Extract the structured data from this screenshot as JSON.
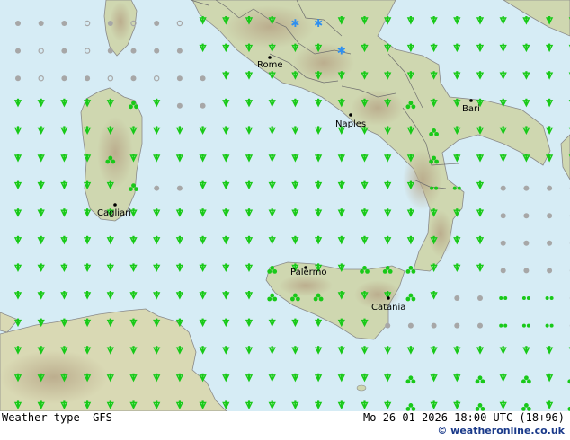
{
  "map": {
    "cities": [
      {
        "id": "rome",
        "name": "Rome"
      },
      {
        "id": "naples",
        "name": "Naples"
      },
      {
        "id": "bari",
        "name": "Bari"
      },
      {
        "id": "cagliari",
        "name": "Cagliari"
      },
      {
        "id": "palermo",
        "name": "Palermo"
      },
      {
        "id": "catania",
        "name": "Catania"
      }
    ],
    "symbol_legend": {
      "rain": "rain-icon",
      "showers": "showers-icon",
      "snow": "snow-icon",
      "drizzle": "drizzle-icon",
      "cloudy": "cloudy-icon"
    },
    "colors": {
      "sea": "#d6ecf5",
      "land": "#d2dbb4",
      "rain": "#19c919",
      "snow": "#2e8ff0",
      "cloud": "#a7a7a7"
    }
  },
  "footer": {
    "title": "Weather type",
    "model": "GFS",
    "valid_time": "Mo 26-01-2026 18:00 UTC (18+96)",
    "copyright": "© weatheronline.co.uk"
  }
}
